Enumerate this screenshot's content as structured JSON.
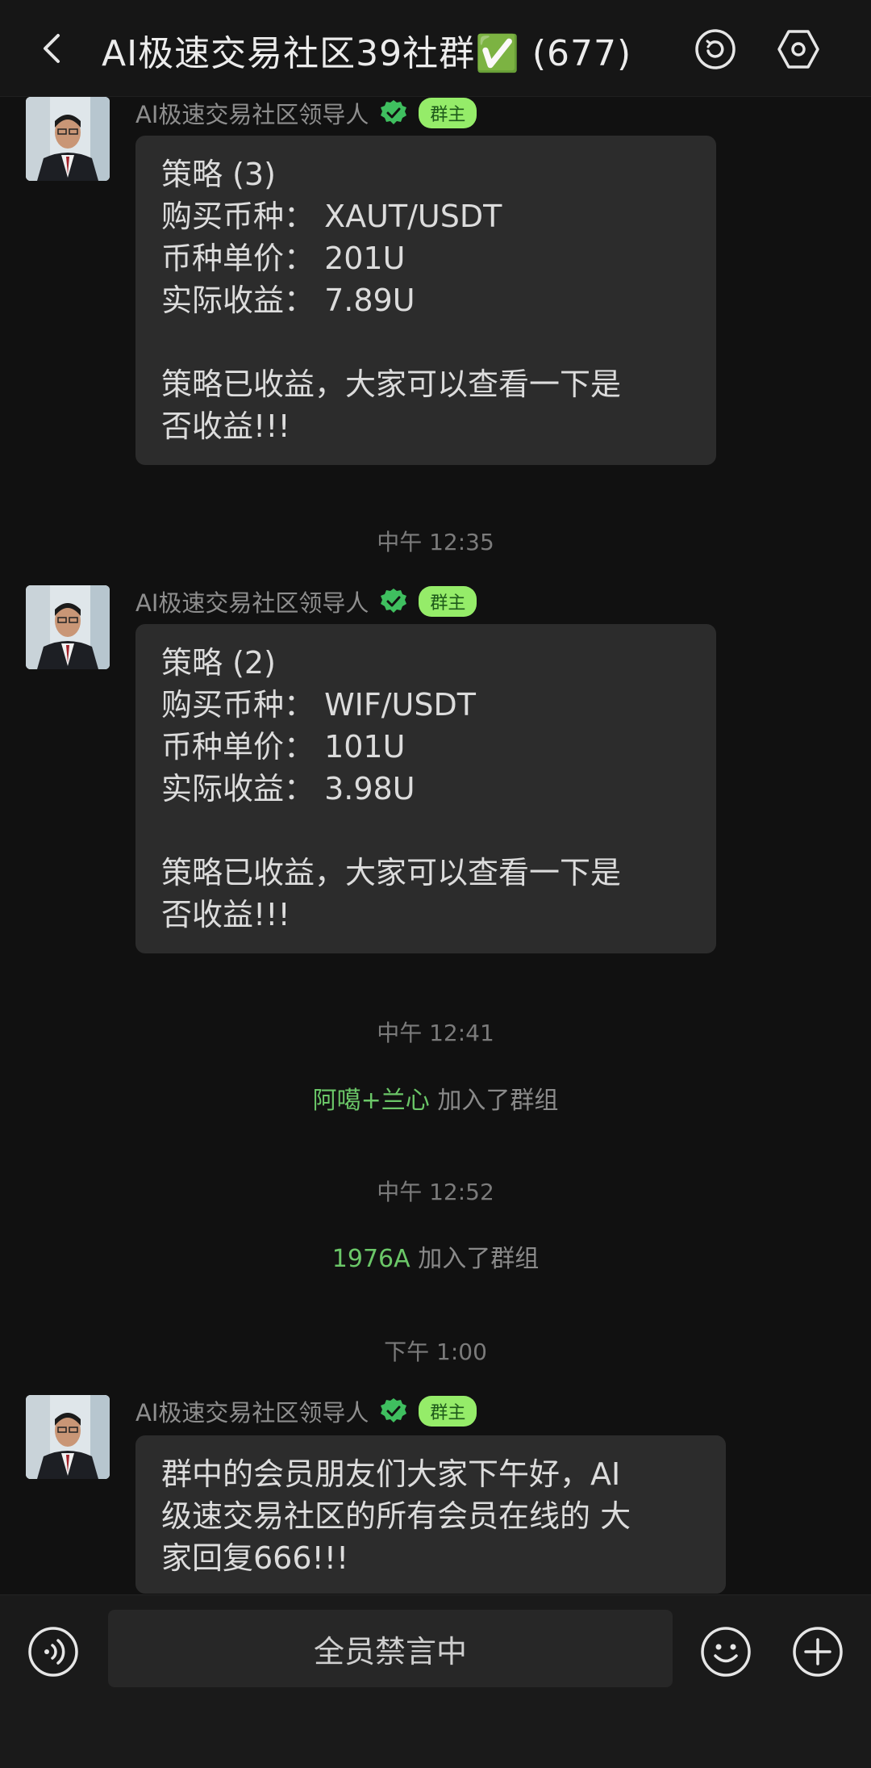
{
  "header": {
    "title": "AI极速交易社区39社群✅ (677)"
  },
  "messages": [
    {
      "sender": "AI极速交易社区领导人",
      "role_badge": "群主",
      "lines": [
        "策略 (3)",
        "购买币种： XAUT/USDT",
        "币种单价： 201U",
        "实际收益： 7.89U",
        "",
        "策略已收益，大家可以查看一下是",
        "否收益!!!"
      ]
    },
    {
      "time": "中午 12:35"
    },
    {
      "sender": "AI极速交易社区领导人",
      "role_badge": "群主",
      "lines": [
        "策略 (2)",
        "购买币种： WIF/USDT",
        "币种单价： 101U",
        "实际收益： 3.98U",
        "",
        "策略已收益，大家可以查看一下是",
        "否收益!!!"
      ]
    }
  ],
  "timestamps": [
    "中午 12:35",
    "中午 12:41",
    "中午 12:52",
    "下午 1:00"
  ],
  "system_events": [
    {
      "name": "阿噶+兰心",
      "text": "加入了群组"
    },
    {
      "name": "1976A",
      "text": "加入了群组"
    }
  ],
  "last_message": {
    "sender": "AI极速交易社区领导人",
    "role_badge": "群主",
    "lines": [
      "群中的会员朋友们大家下午好，AI",
      "级速交易社区的所有会员在线的 大",
      "家回复666!!!"
    ]
  },
  "input_bar": {
    "muted_label": "全员禁言中"
  },
  "colors": {
    "background": "#111111",
    "bubble": "#2c2c2c",
    "badge": "#95ec69",
    "verified": "#3fbf5f",
    "system_name": "#6bc768"
  },
  "icons": [
    "back-icon",
    "chat-history-icon",
    "settings-icon",
    "verified-icon",
    "voice-icon",
    "emoji-icon",
    "plus-icon"
  ]
}
